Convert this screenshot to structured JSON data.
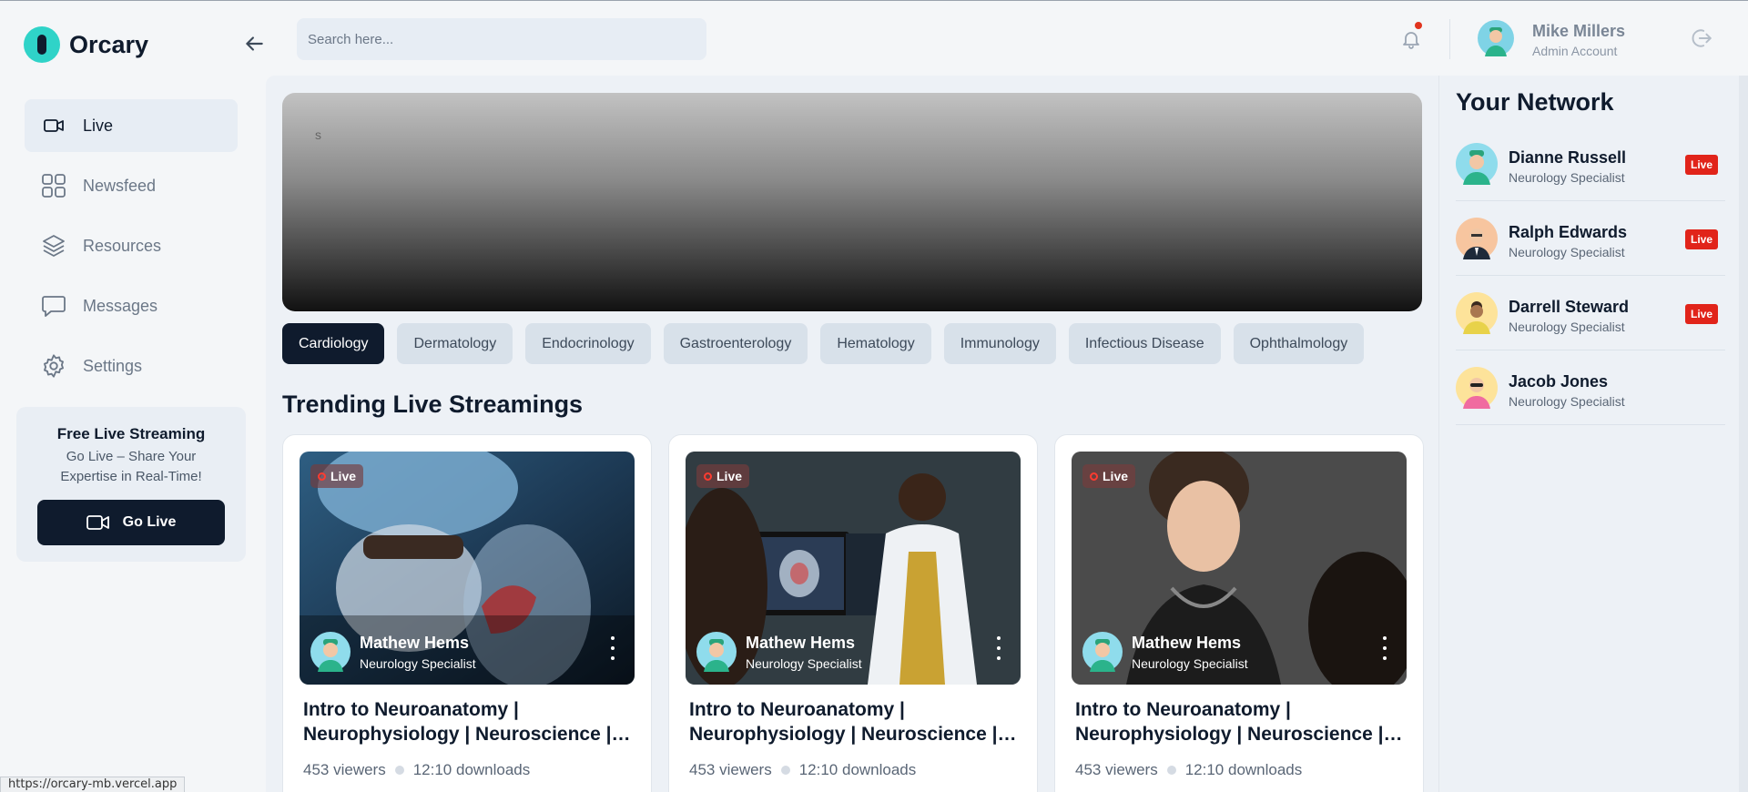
{
  "app": {
    "name": "Orcary"
  },
  "search": {
    "placeholder": "Search here..."
  },
  "user": {
    "name": "Mike Millers",
    "role": "Admin Account"
  },
  "sidebar": {
    "items": [
      {
        "label": "Live",
        "icon": "video-icon",
        "active": true
      },
      {
        "label": "Newsfeed",
        "icon": "grid-icon"
      },
      {
        "label": "Resources",
        "icon": "layers-icon"
      },
      {
        "label": "Messages",
        "icon": "chat-icon"
      },
      {
        "label": "Settings",
        "icon": "gear-icon"
      }
    ],
    "promo": {
      "title": "Free Live Streaming",
      "subtitle": "Go Live – Share Your Expertise in Real-Time!",
      "button": "Go Live"
    }
  },
  "banner": {
    "text": "s"
  },
  "categories": [
    "Cardiology",
    "Dermatology",
    "Endocrinology",
    "Gastroenterology",
    "Hematology",
    "Immunology",
    "Infectious Disease",
    "Ophthalmology"
  ],
  "trending": {
    "title": "Trending Live Streamings",
    "cards": [
      {
        "live": "Live",
        "host": "Mathew Hems",
        "host_role": "Neurology Specialist",
        "title_line1": "Intro to Neuroanatomy |",
        "title_line2": "Neurophysiology | Neuroscience | Medicine",
        "viewers": "453 viewers",
        "downloads": "12:10 downloads"
      },
      {
        "live": "Live",
        "host": "Mathew Hems",
        "host_role": "Neurology Specialist",
        "title_line1": "Intro to Neuroanatomy |",
        "title_line2": "Neurophysiology | Neuroscience | Medicine",
        "viewers": "453 viewers",
        "downloads": "12:10 downloads"
      },
      {
        "live": "Live",
        "host": "Mathew Hems",
        "host_role": "Neurology Specialist",
        "title_line1": "Intro to Neuroanatomy |",
        "title_line2": "Neurophysiology | Neuroscience | Medicine",
        "viewers": "453 viewers",
        "downloads": "12:10 downloads"
      }
    ]
  },
  "network": {
    "title": "Your Network",
    "people": [
      {
        "name": "Dianne Russell",
        "role": "Neurology Specialist",
        "live": "Live"
      },
      {
        "name": "Ralph Edwards",
        "role": "Neurology Specialist",
        "live": "Live"
      },
      {
        "name": "Darrell Steward",
        "role": "Neurology Specialist",
        "live": "Live"
      },
      {
        "name": "Jacob Jones",
        "role": "Neurology Specialist",
        "live": null
      }
    ]
  },
  "status_bar": {
    "url": "https://orcary-mb.vercel.app"
  },
  "colors": {
    "primary": "#0f1b2d",
    "accent": "#2fd3c8",
    "live": "#e1241a"
  }
}
